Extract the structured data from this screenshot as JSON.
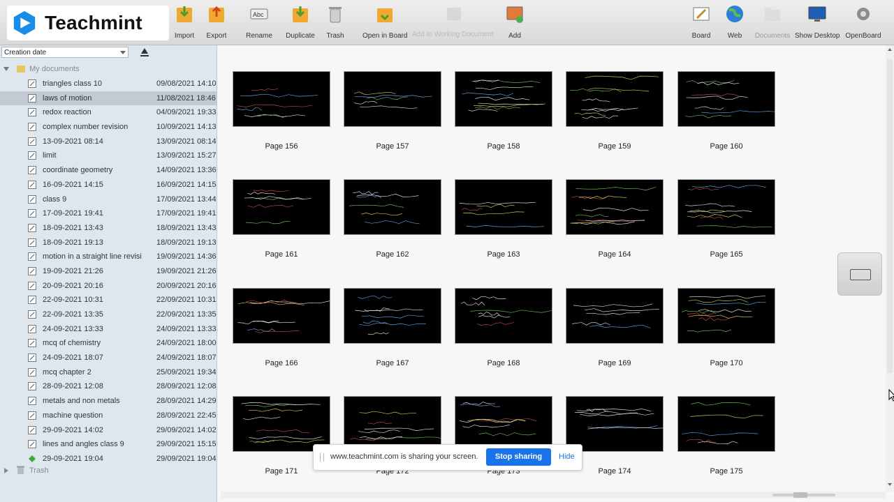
{
  "toolbar": {
    "items": [
      {
        "label": "Import",
        "icon": "import-icon",
        "disabled": false
      },
      {
        "label": "Export",
        "icon": "export-icon",
        "disabled": false
      },
      {
        "label": "Rename",
        "icon": "rename-icon",
        "disabled": false
      },
      {
        "label": "Duplicate",
        "icon": "duplicate-icon",
        "disabled": false
      },
      {
        "label": "Trash",
        "icon": "trash-icon",
        "disabled": false
      },
      {
        "label": "Open in Board",
        "icon": "open-in-board-icon",
        "disabled": false
      },
      {
        "label": "",
        "icon": "add-to-document-icon",
        "disabled": true
      },
      {
        "label": "Add",
        "icon": "add-icon",
        "disabled": false
      },
      {
        "label": "Board",
        "icon": "board-icon",
        "disabled": false
      },
      {
        "label": "Web",
        "icon": "globe-icon",
        "disabled": false
      },
      {
        "label": "Documents",
        "icon": "folder-icon",
        "disabled": true
      },
      {
        "label": "Show Desktop",
        "icon": "desktop-icon",
        "disabled": false
      },
      {
        "label": "OpenBoard",
        "icon": "gear-icon",
        "disabled": false
      }
    ],
    "ghost_label": "Add to Working Document"
  },
  "logo": {
    "text": "Teachmint",
    "color": "#1a8ee6"
  },
  "sidebar": {
    "sort_select": "Creation date",
    "root_label": "My documents",
    "trash_label": "Trash",
    "documents": [
      {
        "name": "triangles class 10",
        "date": "09/08/2021 14:10"
      },
      {
        "name": "laws of motion",
        "date": "11/08/2021 18:46",
        "selected": true
      },
      {
        "name": "redox reaction",
        "date": "04/09/2021 19:33"
      },
      {
        "name": "complex number revision",
        "date": "10/09/2021 14:13"
      },
      {
        "name": "13-09-2021 08:14",
        "date": "13/09/2021 08:14"
      },
      {
        "name": "limit",
        "date": "13/09/2021 15:27"
      },
      {
        "name": "coordinate geometry",
        "date": "14/09/2021 13:36"
      },
      {
        "name": "16-09-2021 14:15",
        "date": "16/09/2021 14:15"
      },
      {
        "name": "class 9",
        "date": "17/09/2021 13:44"
      },
      {
        "name": "17-09-2021 19:41",
        "date": "17/09/2021 19:41"
      },
      {
        "name": "18-09-2021 13:43",
        "date": "18/09/2021 13:43"
      },
      {
        "name": "18-09-2021 19:13",
        "date": "18/09/2021 19:13"
      },
      {
        "name": "motion in a straight line revisi",
        "date": "19/09/2021 14:36"
      },
      {
        "name": "19-09-2021 21:26",
        "date": "19/09/2021 21:26"
      },
      {
        "name": "20-09-2021 20:16",
        "date": "20/09/2021 20:16"
      },
      {
        "name": "22-09-2021 10:31",
        "date": "22/09/2021 10:31"
      },
      {
        "name": "22-09-2021 13:35",
        "date": "22/09/2021 13:35"
      },
      {
        "name": "24-09-2021 13:33",
        "date": "24/09/2021 13:33"
      },
      {
        "name": "mcq of chemistry",
        "date": "24/09/2021 18:00"
      },
      {
        "name": "24-09-2021 18:07",
        "date": "24/09/2021 18:07"
      },
      {
        "name": "mcq chapter 2",
        "date": "25/09/2021 19:34"
      },
      {
        "name": "28-09-2021 12:08",
        "date": "28/09/2021 12:08"
      },
      {
        "name": "metals and non metals",
        "date": "28/09/2021 14:29"
      },
      {
        "name": "machine question",
        "date": "28/09/2021 22:45"
      },
      {
        "name": "29-09-2021 14:02",
        "date": "29/09/2021 14:02"
      },
      {
        "name": "lines and angles class 9",
        "date": "29/09/2021 15:15"
      },
      {
        "name": "29-09-2021 19:04",
        "date": "29/09/2021 19:04",
        "current": true
      }
    ]
  },
  "pages": [
    "Page 156",
    "Page 157",
    "Page 158",
    "Page 159",
    "Page 160",
    "Page 161",
    "Page 162",
    "Page 163",
    "Page 164",
    "Page 165",
    "Page 166",
    "Page 167",
    "Page 168",
    "Page 169",
    "Page 170",
    "Page 171",
    "Page 172",
    "Page 173",
    "Page 174",
    "Page 175"
  ],
  "share_bar": {
    "message": "www.teachmint.com is sharing your screen.",
    "stop_label": "Stop sharing",
    "hide_label": "Hide",
    "accent": "#1a73e8"
  }
}
